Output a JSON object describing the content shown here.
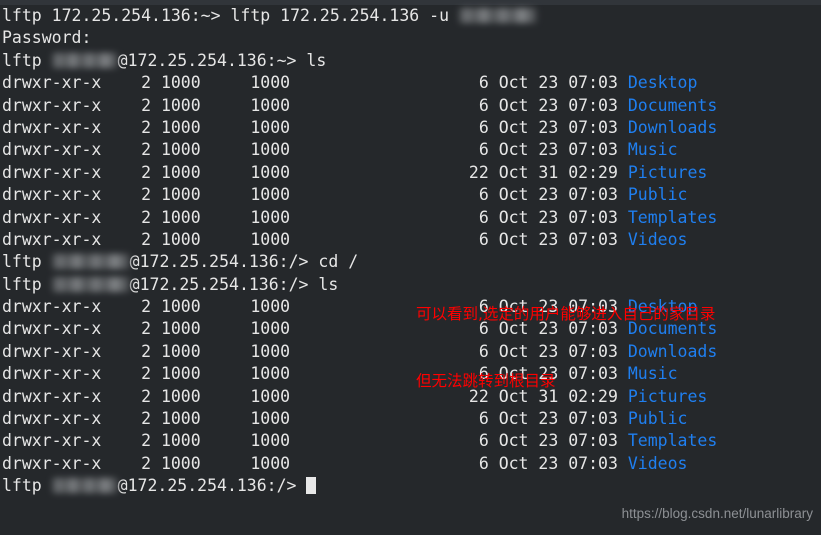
{
  "terminal": {
    "host": "172.25.254.136",
    "redacted_username": "[redacted]",
    "prompt_home": "lftp 172.25.254.136:~> ",
    "command_connect": "lftp 172.25.254.136 -u ",
    "password_prompt": "Password:",
    "prompt_user_home_prefix": "lftp ",
    "prompt_user_home_suffix": "@172.25.254.136:~> ",
    "prompt_user_root_suffix": "@172.25.254.136:/> ",
    "command_ls": "ls",
    "command_cd_root": "cd /",
    "cursor": "block-cursor"
  },
  "listing": {
    "perms": "drwxr-xr-x",
    "links": "2",
    "owner": "1000",
    "group": "1000",
    "entries": [
      {
        "size": "6",
        "month": "Oct",
        "day": "23",
        "time": "07:03",
        "name": "Desktop"
      },
      {
        "size": "6",
        "month": "Oct",
        "day": "23",
        "time": "07:03",
        "name": "Documents"
      },
      {
        "size": "6",
        "month": "Oct",
        "day": "23",
        "time": "07:03",
        "name": "Downloads"
      },
      {
        "size": "6",
        "month": "Oct",
        "day": "23",
        "time": "07:03",
        "name": "Music"
      },
      {
        "size": "22",
        "month": "Oct",
        "day": "31",
        "time": "02:29",
        "name": "Pictures"
      },
      {
        "size": "6",
        "month": "Oct",
        "day": "23",
        "time": "07:03",
        "name": "Public"
      },
      {
        "size": "6",
        "month": "Oct",
        "day": "23",
        "time": "07:03",
        "name": "Templates"
      },
      {
        "size": "6",
        "month": "Oct",
        "day": "23",
        "time": "07:03",
        "name": "Videos"
      }
    ]
  },
  "annotation": {
    "line1": "可以看到,选定的用户能够进入自己的家目录",
    "line2": "但无法跳转到根目录",
    "color": "#ff0000"
  },
  "watermark": {
    "text": "https://blog.csdn.net/lunarlibrary"
  },
  "colors": {
    "background": "#25282b",
    "foreground": "#e6e6e6",
    "directory": "#1f7ff0",
    "annotation": "#ff0000",
    "watermark": "#8d9094"
  }
}
